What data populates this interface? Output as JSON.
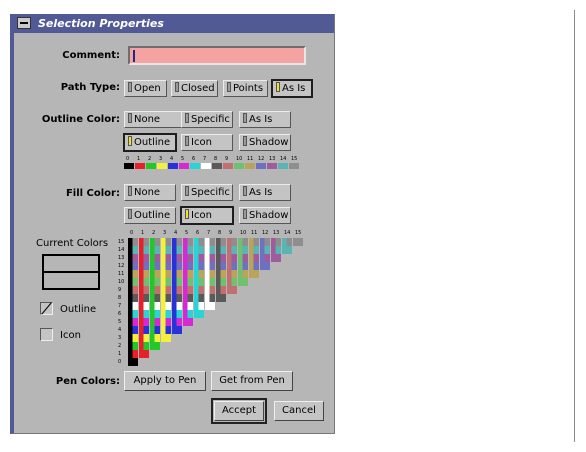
{
  "window": {
    "title": "Selection Properties"
  },
  "comment": {
    "label": "Comment:",
    "value": ""
  },
  "path_type": {
    "label": "Path Type:",
    "options": [
      "Open",
      "Closed",
      "Points",
      "As Is"
    ],
    "selected": "As Is"
  },
  "outline_color": {
    "label": "Outline Color:",
    "row1": [
      "None",
      "Specific",
      "As Is"
    ],
    "row2": [
      "Outline",
      "Icon",
      "Shadow"
    ],
    "selected": "Outline"
  },
  "fill_color": {
    "label": "Fill Color:",
    "row1": [
      "None",
      "Specific",
      "As Is"
    ],
    "row2": [
      "Outline",
      "Icon",
      "Shadow"
    ],
    "selected": "Icon"
  },
  "palette": {
    "numbers": [
      "0",
      "1",
      "2",
      "3",
      "4",
      "5",
      "6",
      "7",
      "8",
      "9",
      "10",
      "11",
      "12",
      "13",
      "14",
      "15"
    ],
    "colors": [
      "#000000",
      "#e8202a",
      "#22c828",
      "#f2f23c",
      "#2832d8",
      "#d42ad4",
      "#28d4d4",
      "#ffffff",
      "#5a5a5a",
      "#c07070",
      "#70c070",
      "#b8a45a",
      "#7070c0",
      "#a05aa0",
      "#5ab4b4",
      "#8e8e8e"
    ]
  },
  "current_colors": {
    "label": "Current Colors",
    "outline_label": "Outline",
    "icon_label": "Icon"
  },
  "grid": {
    "col_numbers": [
      "0",
      "1",
      "2",
      "3",
      "4",
      "5",
      "6",
      "7",
      "8",
      "9",
      "10",
      "11",
      "12",
      "13",
      "14",
      "15"
    ],
    "row_numbers": [
      "15",
      "14",
      "13",
      "12",
      "11",
      "10",
      "9",
      "8",
      "7",
      "6",
      "5",
      "4",
      "3",
      "2",
      "1",
      "0"
    ]
  },
  "pen_colors": {
    "label": "Pen Colors:",
    "apply": "Apply to Pen",
    "get": "Get from Pen"
  },
  "actions": {
    "accept": "Accept",
    "cancel": "Cancel"
  }
}
